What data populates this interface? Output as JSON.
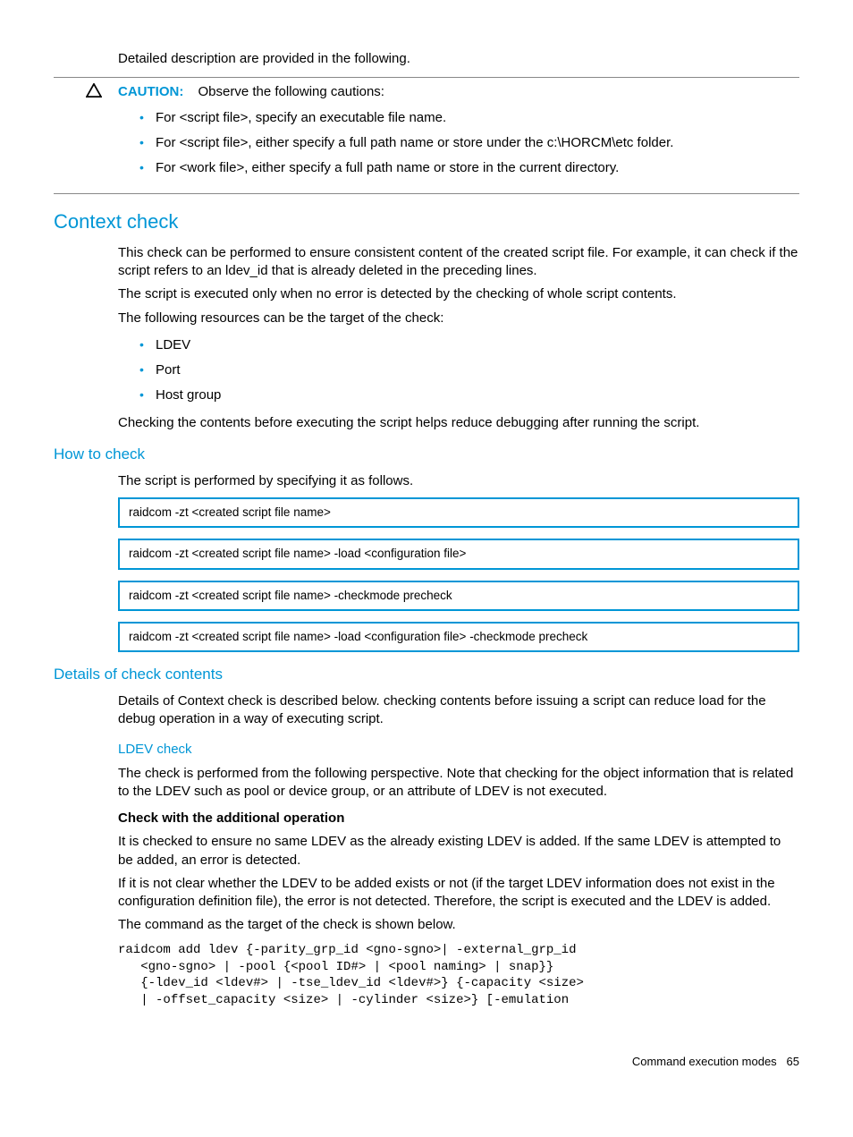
{
  "intro_para": "Detailed description are provided in the following.",
  "caution": {
    "label": "CAUTION:",
    "text": "Observe the following cautions:",
    "bullets": [
      "For <script file>, specify an executable file name.",
      "For <script file>, either specify a full path name or store under the c:\\HORCM\\etc folder.",
      "For <work file>, either specify a full path name or store in the current directory."
    ]
  },
  "context": {
    "heading": "Context check",
    "p1": "This check can be performed to ensure consistent content of the created script file. For example, it can check if the script refers to an ldev_id that is already deleted in the preceding lines.",
    "p2": "The script is executed only when no error is detected by the checking of whole script contents.",
    "p3": "The following resources can be the target of the check:",
    "bullets": [
      "LDEV",
      "Port",
      "Host group"
    ],
    "p4": "Checking the contents before executing the script helps reduce debugging after running the script."
  },
  "how": {
    "heading": "How to check",
    "p1": "The script is performed by specifying it as follows.",
    "boxes": [
      "raidcom -zt <created script file name>",
      "raidcom -zt <created script file name> -load <configuration file>",
      "raidcom -zt <created script file name> -checkmode precheck",
      "raidcom -zt <created script file name> -load <configuration file> -checkmode precheck"
    ]
  },
  "details": {
    "heading": "Details of check contents",
    "p1": "Details of Context check is described below. checking contents before issuing a script can reduce load for the debug operation in a way of executing script.",
    "ldev_heading": "LDEV check",
    "ldev_p1": "The check is performed from the following perspective. Note that checking for the object information that is related to the LDEV such as pool or device group, or an attribute of LDEV is not executed.",
    "bold1": "Check with the additional operation",
    "p2": "It is checked to ensure no same LDEV as the already existing LDEV is added. If the same LDEV is attempted to be added, an error is detected.",
    "p3": "If it is not clear whether the LDEV to be added exists or not (if the target LDEV information does not exist in the configuration definition file), the error is not detected. Therefore, the script is executed and the LDEV is added.",
    "p4": "The command as the target of the check is shown below.",
    "code": "raidcom add ldev {-parity_grp_id <gno-sgno>| -external_grp_id\n   <gno-sgno> | -pool {<pool ID#> | <pool naming> | snap}}\n   {-ldev_id <ldev#> | -tse_ldev_id <ldev#>} {-capacity <size>\n   | -offset_capacity <size> | -cylinder <size>} [-emulation"
  },
  "footer": {
    "text": "Command execution modes",
    "page": "65"
  }
}
